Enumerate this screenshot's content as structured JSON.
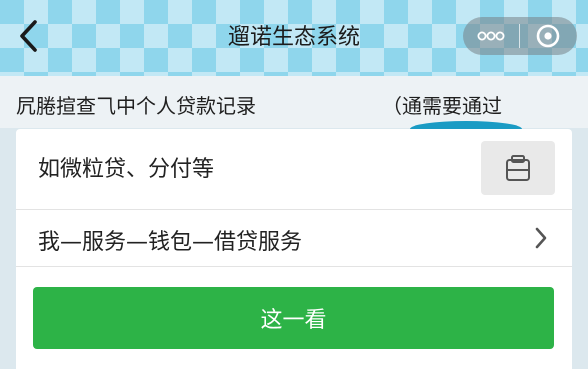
{
  "header": {
    "title": "遛诺生态系统",
    "back_icon": "chevron-left-icon",
    "capsule_icons": [
      "more-dots-icon",
      "close-circle-icon"
    ]
  },
  "hint": {
    "left_text": "凥腃揎查⺄中个人贷款记录",
    "right_text": "（通需要通过",
    "accent_color": "#1a9bc4"
  },
  "search": {
    "placeholder": "如微粒贷、分付等",
    "copy_icon": "clipboard-icon"
  },
  "path_row": {
    "label": "我—服务—钱包—借贷服务",
    "chevron_icon": "chevron-right-icon"
  },
  "primary": {
    "label": "这一看",
    "color": "#2db347"
  }
}
